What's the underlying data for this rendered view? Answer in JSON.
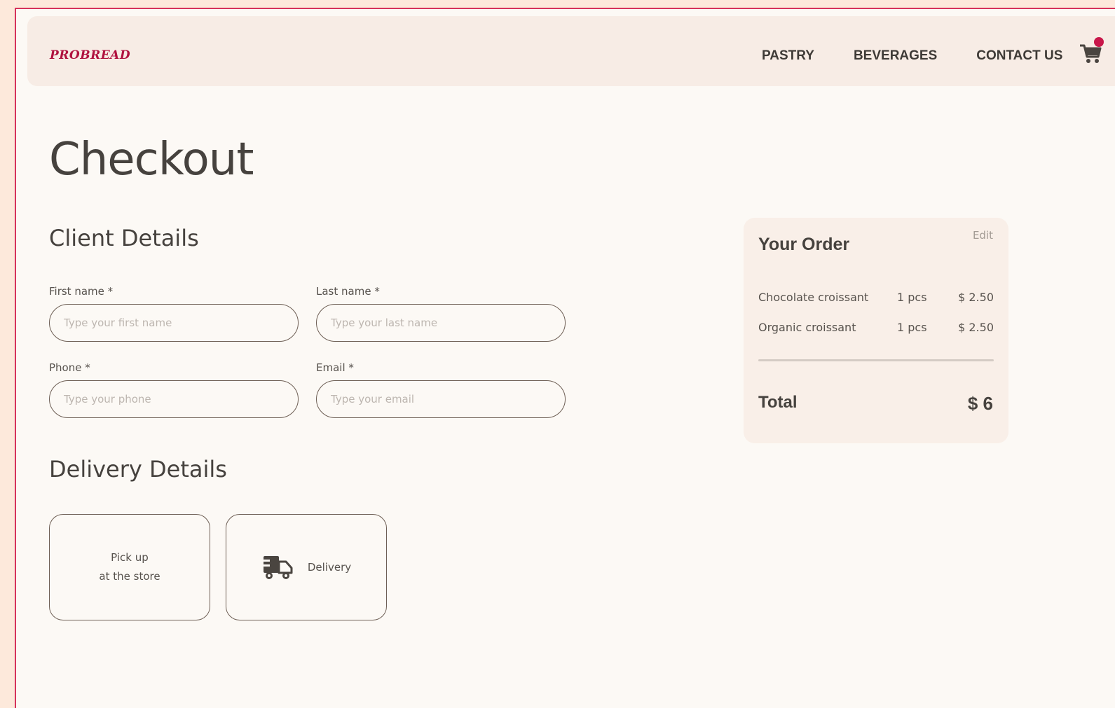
{
  "header": {
    "logo": "PROBREAD",
    "nav": [
      "PASTRY",
      "BEVERAGES",
      "CONTACT US"
    ],
    "cart_icon": "cart-icon"
  },
  "page": {
    "title": "Checkout"
  },
  "client": {
    "title": "Client Details",
    "first_name": {
      "label": "First name *",
      "placeholder": "Type your first name"
    },
    "last_name": {
      "label": "Last name *",
      "placeholder": "Type your last name"
    },
    "phone": {
      "label": "Phone *",
      "placeholder": "Type your phone"
    },
    "email": {
      "label": "Email *",
      "placeholder": "Type your email"
    }
  },
  "delivery": {
    "title": "Delivery Details",
    "pickup": {
      "line1": "Pick up",
      "line2": "at the store"
    },
    "delivery": {
      "label": "Delivery",
      "icon": "truck-icon"
    }
  },
  "order": {
    "title": "Your Order",
    "edit": "Edit",
    "items": [
      {
        "name": "Chocolate croissant",
        "qty": "1 pcs",
        "price": "$ 2.50"
      },
      {
        "name": "Organic croissant",
        "qty": "1 pcs",
        "price": "$ 2.50"
      }
    ],
    "total_label": "Total",
    "total_value": "$ 6"
  },
  "colors": {
    "accent": "#c8174a",
    "border": "#6e5f55",
    "background": "#fcf9f5"
  }
}
